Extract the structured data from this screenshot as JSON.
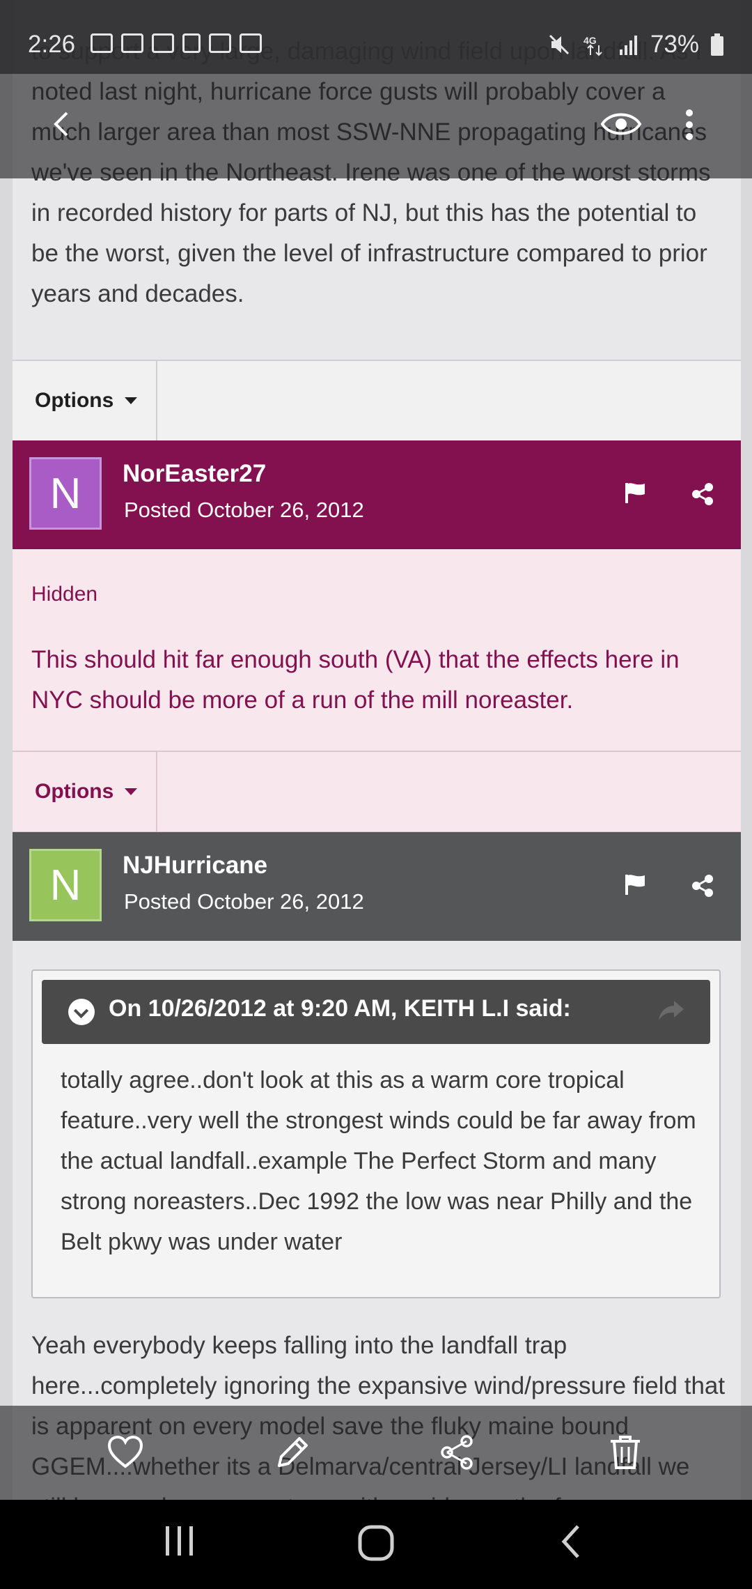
{
  "status_bar": {
    "time": "2:26",
    "notification_icons": [
      "message-icon",
      "message-icon",
      "message-icon",
      "cast-icon",
      "news-icon",
      "image-icon"
    ],
    "right_icons": [
      "mute-icon",
      "4g-icon",
      "signal-icon"
    ],
    "battery": "73%"
  },
  "top_post": {
    "text": "to support a very large, damaging wind field upon landfall. As I noted last night, hurricane force gusts will probably cover a much larger area than most SSW-NNE propagating hurricanes we've seen in the Northeast. Irene was one of the worst storms in recorded history for parts of NJ, but this has the potential to be the worst, given the level of infrastructure compared to prior years and decades.",
    "options_label": "Options"
  },
  "post2": {
    "avatar_letter": "N",
    "author": "NorEaster27",
    "posted": "Posted October 26, 2012",
    "status": "Hidden",
    "text": "This should hit far enough south (VA) that the effects here in NYC should be more of a run of the mill noreaster.",
    "options_label": "Options"
  },
  "post3": {
    "avatar_letter": "N",
    "author": "NJHurricane",
    "posted": "Posted October 26, 2012",
    "quote_header": "On 10/26/2012 at 9:20 AM, KEITH L.I said:",
    "quote_text": "totally agree..don't look at this as a warm core tropical feature..very well the strongest winds could be far away from the actual landfall..example The Perfect Storm and many strong noreasters..Dec 1992 the low was near Philly and the Belt pkwy was under water",
    "reply_text": "Yeah everybody keeps falling into the landfall trap here...completely ignoring the expansive wind/pressure field that is apparent on every model save the fluky maine bound GGEM....whether its a Delmarva/central Jersey/LI landfall we still have a dangerous storm with a wide swath of"
  },
  "colors": {
    "hidden_bar": "#84114f",
    "hidden_bg": "#f8e8ee",
    "hidden_text": "#84114f",
    "avatar_purple": "#a95bc6",
    "avatar_green": "#97c55b",
    "gray_bar": "#555657"
  }
}
